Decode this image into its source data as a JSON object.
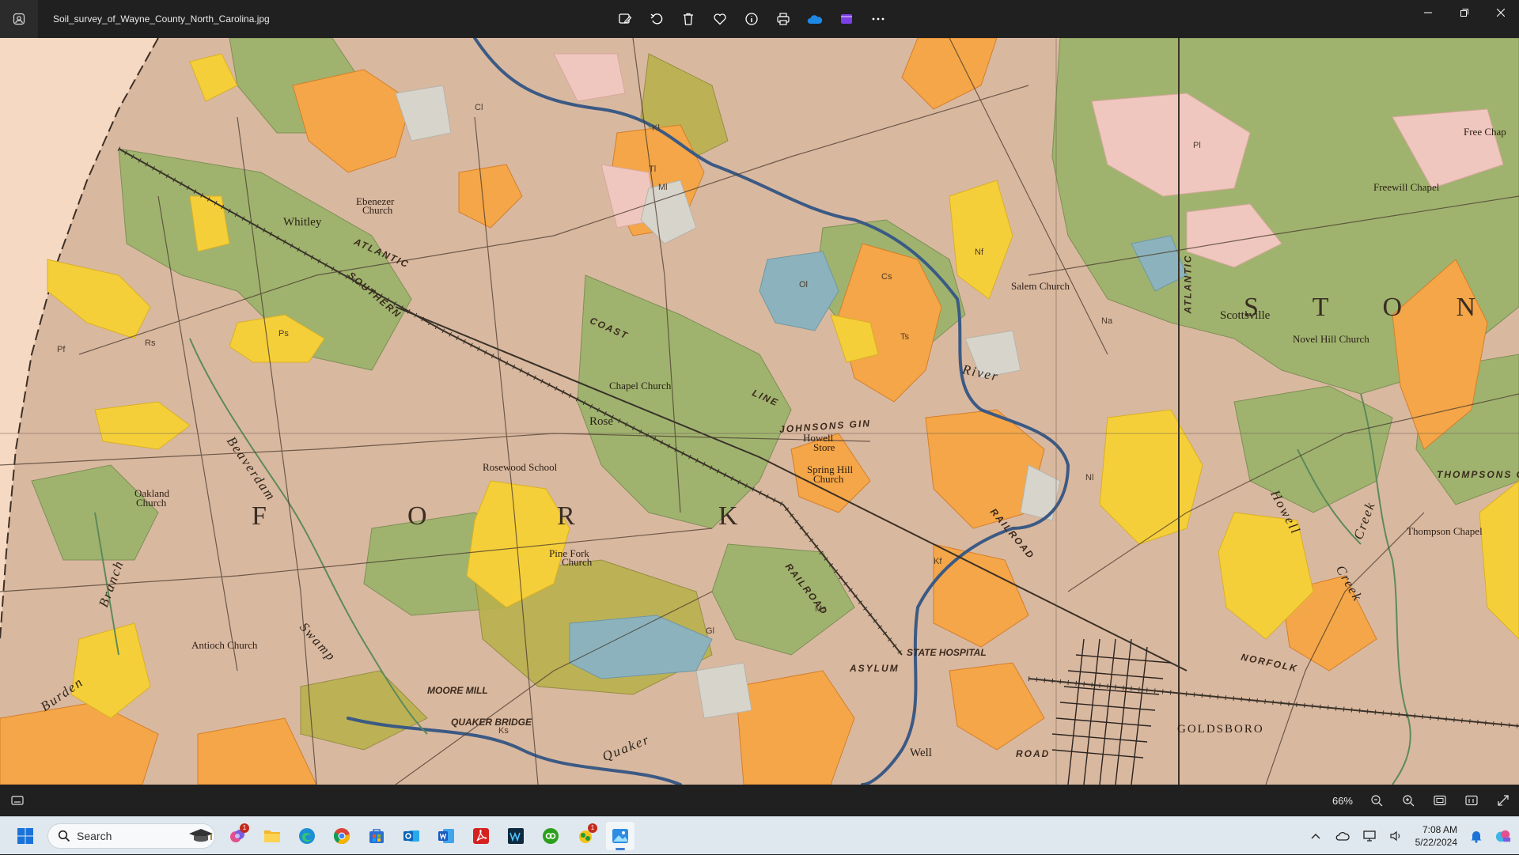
{
  "window": {
    "filename": "Soil_survey_of_Wayne_County_North_Carolina.jpg",
    "toolbar_icons": [
      "edit-image-icon",
      "rotate-icon",
      "delete-icon",
      "favorite-icon",
      "info-icon",
      "print-icon",
      "onedrive-icon",
      "clipchamp-icon",
      "more-icon"
    ],
    "controls": [
      "minimize-icon",
      "restore-icon",
      "close-icon"
    ]
  },
  "map": {
    "places": {
      "whitley": "Whitley",
      "ebenezer": "Ebenezer",
      "ebenezer_church": "Church",
      "chapel_church": "Chapel Church",
      "rose": "Rose",
      "rosewood_school": "Rosewood School",
      "oakland": "Oakland",
      "oakland_church": "Church",
      "pine_fork": "Pine Fork",
      "pine_fork_church": "Church",
      "antioch_church": "Antioch Church",
      "howell": "Howell",
      "howell_store": "Store",
      "spring_hill": "Spring Hill",
      "spring_hill_church": "Church",
      "johnsons_gin": "JOHNSONS GIN",
      "salem_church": "Salem Church",
      "scottsville": "Scottsville",
      "novel_hill_church": "Novel Hill Church",
      "freewill_chapel": "Freewill Chapel",
      "free_chap": "Free Chap",
      "thompsons": "THOMPSONS G",
      "thompson_chapel": "Thompson Chapel",
      "goldsboro": "GOLDSBORO",
      "asylum": "ASYLUM",
      "state_hospital": "STATE HOSPITAL",
      "moore_mill": "MOORE MILL",
      "quaker_bridge": "QUAKER BRIDGE",
      "well": "Well"
    },
    "railroads": {
      "atlantic": "ATLANTIC",
      "southern": "SOUTHERN",
      "coast": "COAST",
      "line": "LINE",
      "railroad_1": "RAILROAD",
      "railroad_2": "RAILROAD",
      "norfolk": "NORFOLK",
      "road": "ROAD",
      "atlantic_v": "ATLANTIC"
    },
    "waterways": {
      "river": "River",
      "beaverdam": "Beaverdam",
      "swamp": "Swamp",
      "branch": "Branch",
      "burden": "Burden",
      "quaker": "Quaker",
      "creek": "Creek",
      "howell": "Howell",
      "creek2": "Creek"
    },
    "township_letters": [
      "F",
      "O",
      "R",
      "K"
    ],
    "township_stony": "S T O N Y",
    "soil_codes": [
      "Ps",
      "Nf",
      "Pf",
      "Rs",
      "Cl",
      "Kl",
      "Ml",
      "Na",
      "Ts",
      "Cs",
      "Ol",
      "Ms",
      "Pl",
      "Ks",
      "Tl",
      "Gl",
      "Kf",
      "Nl"
    ]
  },
  "statusbar": {
    "zoom": "66%",
    "icons": [
      "filmstrip-icon",
      "zoom-out-icon",
      "zoom-in-icon",
      "fit-window-icon",
      "actual-size-icon",
      "fullscreen-icon"
    ]
  },
  "taskbar": {
    "search_placeholder": "Search",
    "apps": [
      {
        "name": "copilot-icon",
        "badge": "1"
      },
      {
        "name": "file-explorer-icon",
        "badge": ""
      },
      {
        "name": "edge-icon",
        "badge": ""
      },
      {
        "name": "chrome-icon",
        "badge": ""
      },
      {
        "name": "store-icon",
        "badge": ""
      },
      {
        "name": "outlook-icon",
        "badge": ""
      },
      {
        "name": "word-icon",
        "badge": ""
      },
      {
        "name": "acrobat-icon",
        "badge": ""
      },
      {
        "name": "waves-icon",
        "badge": ""
      },
      {
        "name": "quickbooks-icon",
        "badge": ""
      },
      {
        "name": "green-app-icon",
        "badge": "1"
      },
      {
        "name": "photos-icon",
        "badge": ""
      }
    ],
    "time": "7:08 AM",
    "date": "5/22/2024"
  },
  "colors": {
    "titlebar": "#202020",
    "map_base": "#d9b8a0",
    "soil_green": "#9fb36f",
    "soil_orange": "#f4a648",
    "soil_yellow": "#f5cf3a",
    "soil_pink": "#f0c7bf",
    "river_blue": "#3b5a84"
  }
}
